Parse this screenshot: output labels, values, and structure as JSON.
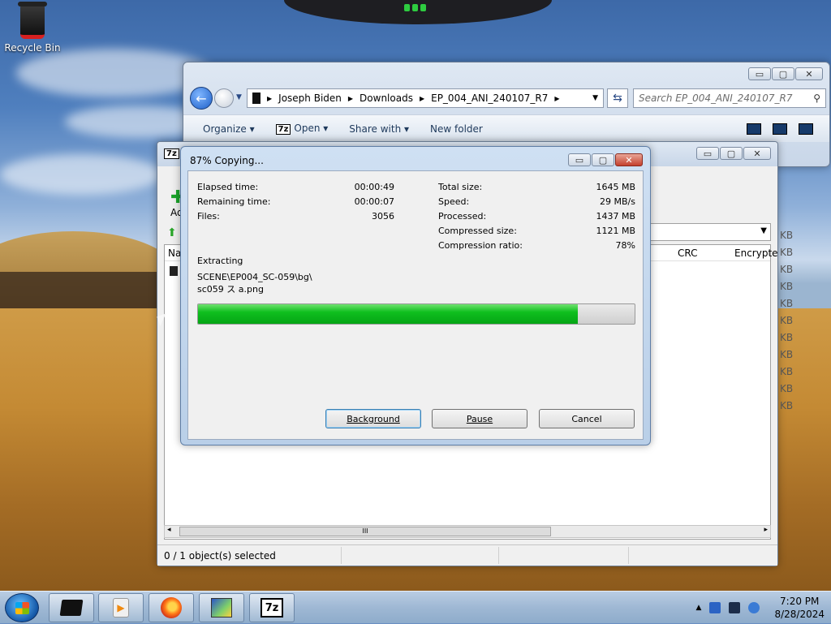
{
  "desktop": {
    "recycle_bin_label": "Recycle Bin"
  },
  "explorer": {
    "path": [
      "Joseph Biden",
      "Downloads",
      "EP_004_ANI_240107_R7"
    ],
    "search_placeholder": "Search EP_004_ANI_240107_R7",
    "commands": {
      "organize": "Organize",
      "open": "Open",
      "share_with": "Share with",
      "new_folder": "New folder"
    },
    "open_icon_text": "7z"
  },
  "filemgr": {
    "logo_text": "7z",
    "add_label": "Ad",
    "columns": {
      "name": "Na",
      "crc": "CRC",
      "encrypted": "Encrypte"
    },
    "kb_labels": [
      "KB",
      "KB",
      "KB",
      "KB",
      "KB",
      "KB",
      "KB",
      "KB",
      "KB",
      "KB",
      "KB"
    ],
    "scroll_thumb_grip": "III",
    "status": "0 / 1 object(s) selected"
  },
  "progress": {
    "title": "87% Copying...",
    "left": {
      "elapsed_label": "Elapsed time:",
      "elapsed_value": "00:00:49",
      "remaining_label": "Remaining time:",
      "remaining_value": "00:00:07",
      "files_label": "Files:",
      "files_value": "3056"
    },
    "right": {
      "total_label": "Total size:",
      "total_value": "1645 MB",
      "speed_label": "Speed:",
      "speed_value": "29 MB/s",
      "processed_label": "Processed:",
      "processed_value": "1437 MB",
      "compressed_label": "Compressed size:",
      "compressed_value": "1121 MB",
      "ratio_label": "Compression ratio:",
      "ratio_value": "78%"
    },
    "operation": "Extracting",
    "file_line1": "SCENE\\EP004_SC-059\\bg\\",
    "file_line2": "sc059 ス a.png",
    "progress_fraction": 0.87,
    "buttons": {
      "background": "Background",
      "pause": "Pause",
      "cancel": "Cancel"
    }
  },
  "caption": {
    "minimize": "▭",
    "maximize": "▢",
    "close": "✕"
  },
  "taskbar": {
    "seven_zip_label": "7z",
    "clock_time": "7:20 PM",
    "clock_date": "8/28/2024"
  },
  "colors": {
    "progress_green": "#0fbf1e",
    "taskbar": "#9fb8d4",
    "close_red": "#c4402d"
  }
}
